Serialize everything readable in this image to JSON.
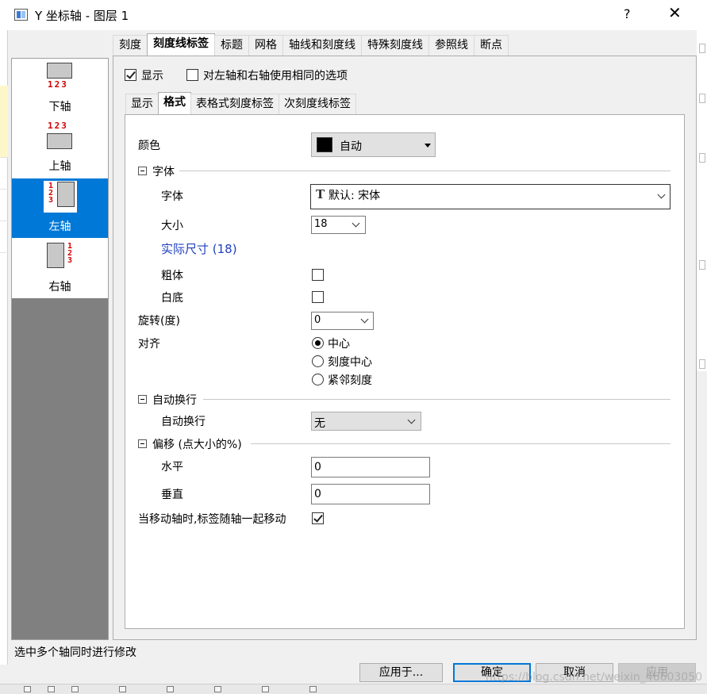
{
  "window": {
    "title": "Y 坐标轴 - 图层 1",
    "help_label": "?",
    "close_label": "✕"
  },
  "main_tabs": [
    "刻度",
    "刻度线标签",
    "标题",
    "网格",
    "轴线和刻度线",
    "特殊刻度线",
    "参照线",
    "断点"
  ],
  "main_tab_active": "刻度线标签",
  "sidebar": {
    "items": [
      {
        "label": "下轴",
        "nums": "123"
      },
      {
        "label": "上轴",
        "nums": "123"
      },
      {
        "label": "左轴",
        "nums": "123"
      },
      {
        "label": "右轴",
        "nums": "123"
      }
    ],
    "selected": "左轴"
  },
  "top_options": {
    "show_label": "显示",
    "show_checked": true,
    "same_options_label": "对左轴和右轴使用相同的选项",
    "same_options_checked": false
  },
  "sub_tabs": [
    "显示",
    "格式",
    "表格式刻度标签",
    "次刻度线标签"
  ],
  "sub_tab_active": "格式",
  "format": {
    "color_label": "颜色",
    "color_value": "自动",
    "color_hex": "#000000",
    "font_section": "字体",
    "font_label": "字体",
    "font_value": "默认: 宋体",
    "size_label": "大小",
    "size_value": "18",
    "actual_size": "实际尺寸 (18)",
    "bold_label": "粗体",
    "bold_checked": false,
    "white_bg_label": "白底",
    "white_bg_checked": false,
    "rotation_label": "旋转(度)",
    "rotation_value": "0",
    "align_label": "对齐",
    "align_options": [
      "中心",
      "刻度中心",
      "紧邻刻度"
    ],
    "align_selected": "中心",
    "wrap_section": "自动换行",
    "wrap_label": "自动换行",
    "wrap_value": "无",
    "offset_section": "偏移 (点大小的%)",
    "horizontal_label": "水平",
    "horizontal_value": "0",
    "vertical_label": "垂直",
    "vertical_value": "0",
    "move_with_axis_label": "当移动轴时,标签随轴一起移动",
    "move_with_axis_checked": true
  },
  "status_text": "选中多个轴同时进行修改",
  "buttons": {
    "apply_to": "应用于...",
    "ok": "确定",
    "cancel": "取消",
    "apply": "应用"
  },
  "watermark": "https://blog.csdn.net/weixin_46603050",
  "colors": {
    "accent": "#0078d7",
    "blue_text": "#1f3fbf",
    "axis_number_red": "#d00000"
  }
}
